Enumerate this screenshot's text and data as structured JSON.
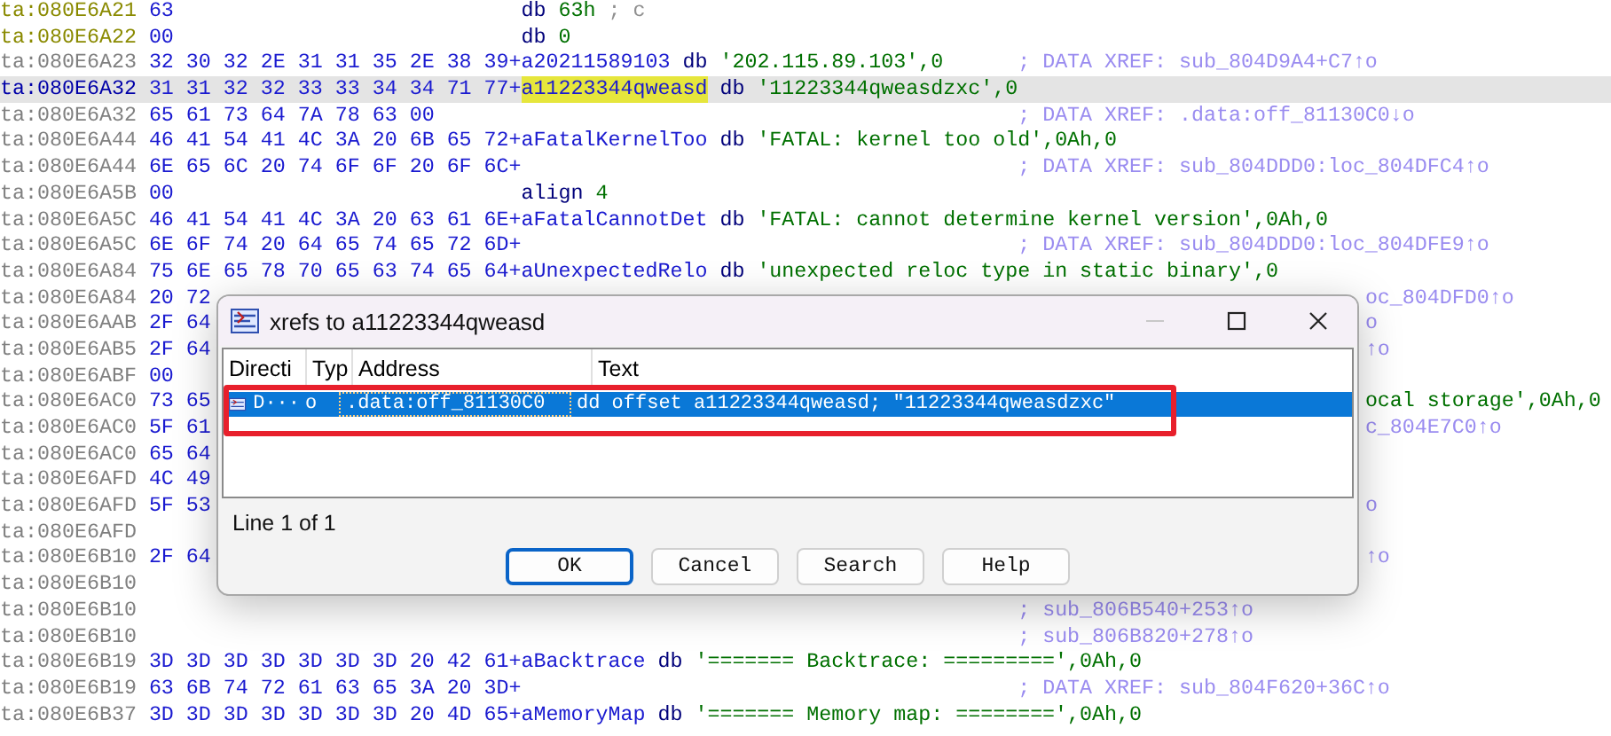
{
  "listing": [
    {
      "kind": "byte",
      "selected": false,
      "address": "ta:080E6A21",
      "bytes": "63",
      "code": [
        {
          "kind": "op",
          "text": "db"
        },
        {
          "kind": "value",
          "text": "63h"
        },
        {
          "kind": "note",
          "text": "; c"
        }
      ]
    },
    {
      "kind": "byte",
      "selected": false,
      "address": "ta:080E6A22",
      "bytes": "00",
      "code": [
        {
          "kind": "op",
          "text": "db"
        },
        {
          "kind": "value",
          "text": "0"
        }
      ]
    },
    {
      "kind": "string",
      "selected": false,
      "address": "ta:080E6A23",
      "bytes": "32 30 32 2E 31 31 35 2E 38 39+",
      "code": [
        {
          "kind": "label",
          "text": "a20211589103",
          "highlighted": false
        },
        {
          "kind": "op",
          "text": "db"
        },
        {
          "kind": "value",
          "text": "'202.115.89.103',0"
        }
      ],
      "comment": "; DATA XREF: sub_804D9A4+C7↑o"
    },
    {
      "kind": "string",
      "selected": true,
      "address": "ta:080E6A32",
      "bytes": "31 31 32 32 33 33 34 34 71 77+",
      "code": [
        {
          "kind": "label",
          "text": "a11223344qweasd",
          "highlighted": true
        },
        {
          "kind": "op",
          "text": "db"
        },
        {
          "kind": "value",
          "text": "'11223344qweasdzxc',0"
        }
      ]
    },
    {
      "kind": "string",
      "selected": false,
      "address": "ta:080E6A32",
      "bytes": "65 61 73 64 7A 78 63 00",
      "comment": "; DATA XREF: .data:off_81130C0↓o"
    },
    {
      "kind": "string",
      "selected": false,
      "address": "ta:080E6A44",
      "bytes": "46 41 54 41 4C 3A 20 6B 65 72+",
      "code": [
        {
          "kind": "label",
          "text": "aFatalKernelToo",
          "highlighted": false
        },
        {
          "kind": "op",
          "text": "db"
        },
        {
          "kind": "value",
          "text": "'FATAL: kernel too old',0Ah,0"
        }
      ]
    },
    {
      "kind": "string",
      "selected": false,
      "address": "ta:080E6A44",
      "bytes": "6E 65 6C 20 74 6F 6F 20 6F 6C+",
      "comment": "; DATA XREF: sub_804DDD0:loc_804DFC4↑o"
    },
    {
      "kind": "string",
      "selected": false,
      "address": "ta:080E6A5B",
      "bytes": "00",
      "code": [
        {
          "kind": "op",
          "text": "align"
        },
        {
          "kind": "value",
          "text": "4"
        }
      ]
    },
    {
      "kind": "string",
      "selected": false,
      "address": "ta:080E6A5C",
      "bytes": "46 41 54 41 4C 3A 20 63 61 6E+",
      "code": [
        {
          "kind": "label",
          "text": "aFatalCannotDet",
          "highlighted": false
        },
        {
          "kind": "op",
          "text": "db"
        },
        {
          "kind": "value",
          "text": "'FATAL: cannot determine kernel version',0Ah,0"
        }
      ]
    },
    {
      "kind": "string",
      "selected": false,
      "address": "ta:080E6A5C",
      "bytes": "6E 6F 74 20 64 65 74 65 72 6D+",
      "comment": "; DATA XREF: sub_804DDD0:loc_804DFE9↑o"
    },
    {
      "kind": "string",
      "selected": false,
      "address": "ta:080E6A84",
      "bytes": "75 6E 65 78 70 65 63 74 65 64+",
      "code": [
        {
          "kind": "label",
          "text": "aUnexpectedRelo",
          "highlighted": false
        },
        {
          "kind": "op",
          "text": "db"
        },
        {
          "kind": "value",
          "text": "'unexpected reloc type in static binary',0"
        }
      ]
    },
    {
      "kind": "string",
      "selected": false,
      "address": "ta:080E6A84",
      "bytes": "20 72",
      "tail": "oc_804DFD0↑o"
    },
    {
      "kind": "string",
      "selected": false,
      "address": "ta:080E6AAB",
      "bytes": "2F 64",
      "tail": "o"
    },
    {
      "kind": "string",
      "selected": false,
      "address": "ta:080E6AB5",
      "bytes": "2F 64",
      "tail": "↑o"
    },
    {
      "kind": "string",
      "selected": false,
      "address": "ta:080E6ABF",
      "bytes": "00"
    },
    {
      "kind": "string",
      "selected": false,
      "address": "ta:080E6AC0",
      "bytes": "73 65",
      "tail": "ocal storage',0Ah,0"
    },
    {
      "kind": "string",
      "selected": false,
      "address": "ta:080E6AC0",
      "bytes": "5F 61",
      "tail": "c_804E7C0↑o"
    },
    {
      "kind": "string",
      "selected": false,
      "address": "ta:080E6AC0",
      "bytes": "65 64"
    },
    {
      "kind": "string",
      "selected": false,
      "address": "ta:080E6AFD",
      "bytes": "4C 49"
    },
    {
      "kind": "string",
      "selected": false,
      "address": "ta:080E6AFD",
      "bytes": "5F 53",
      "tail": "o"
    },
    {
      "kind": "string",
      "selected": false,
      "address": "ta:080E6AFD"
    },
    {
      "kind": "string",
      "selected": false,
      "address": "ta:080E6B10",
      "bytes": "2F 64",
      "tail": "↑o"
    },
    {
      "kind": "string",
      "selected": false,
      "address": "ta:080E6B10"
    },
    {
      "kind": "string",
      "selected": false,
      "address": "ta:080E6B10",
      "comment": "; sub_806B540+253↑o"
    },
    {
      "kind": "string",
      "selected": false,
      "address": "ta:080E6B10",
      "comment": "; sub_806B820+278↑o"
    },
    {
      "kind": "string",
      "selected": false,
      "address": "ta:080E6B19",
      "bytes": "3D 3D 3D 3D 3D 3D 3D 20 42 61+",
      "code": [
        {
          "kind": "label",
          "text": "aBacktrace",
          "highlighted": false
        },
        {
          "kind": "op",
          "text": "db"
        },
        {
          "kind": "value",
          "text": "'======= Backtrace: =========',0Ah,0"
        }
      ]
    },
    {
      "kind": "string",
      "selected": false,
      "address": "ta:080E6B19",
      "bytes": "63 6B 74 72 61 63 65 3A 20 3D+",
      "comment": "; DATA XREF: sub_804F620+36C↑o"
    },
    {
      "kind": "string",
      "selected": false,
      "address": "ta:080E6B37",
      "bytes": "3D 3D 3D 3D 3D 3D 3D 20 4D 65+",
      "code": [
        {
          "kind": "label",
          "text": "aMemoryMap",
          "highlighted": false
        },
        {
          "kind": "op",
          "text": "db"
        },
        {
          "kind": "value",
          "text": "'======= Memory map: ========',0Ah,0"
        }
      ]
    }
  ],
  "dialog": {
    "title": "xrefs to a11223344qweasd",
    "columns": [
      "Directi",
      "Typ",
      "Address",
      "Text"
    ],
    "rows": [
      {
        "direction": "D···",
        "type": "o",
        "address": ".data:off_81130C0",
        "text": "dd offset a11223344qweasd; ″11223344qweasdzxc″",
        "selected": true
      }
    ],
    "status": "Line 1 of 1",
    "buttons": [
      {
        "label": "OK",
        "default": true
      },
      {
        "label": "Cancel",
        "default": false
      },
      {
        "label": "Search",
        "default": false
      },
      {
        "label": "Help",
        "default": false
      }
    ]
  }
}
